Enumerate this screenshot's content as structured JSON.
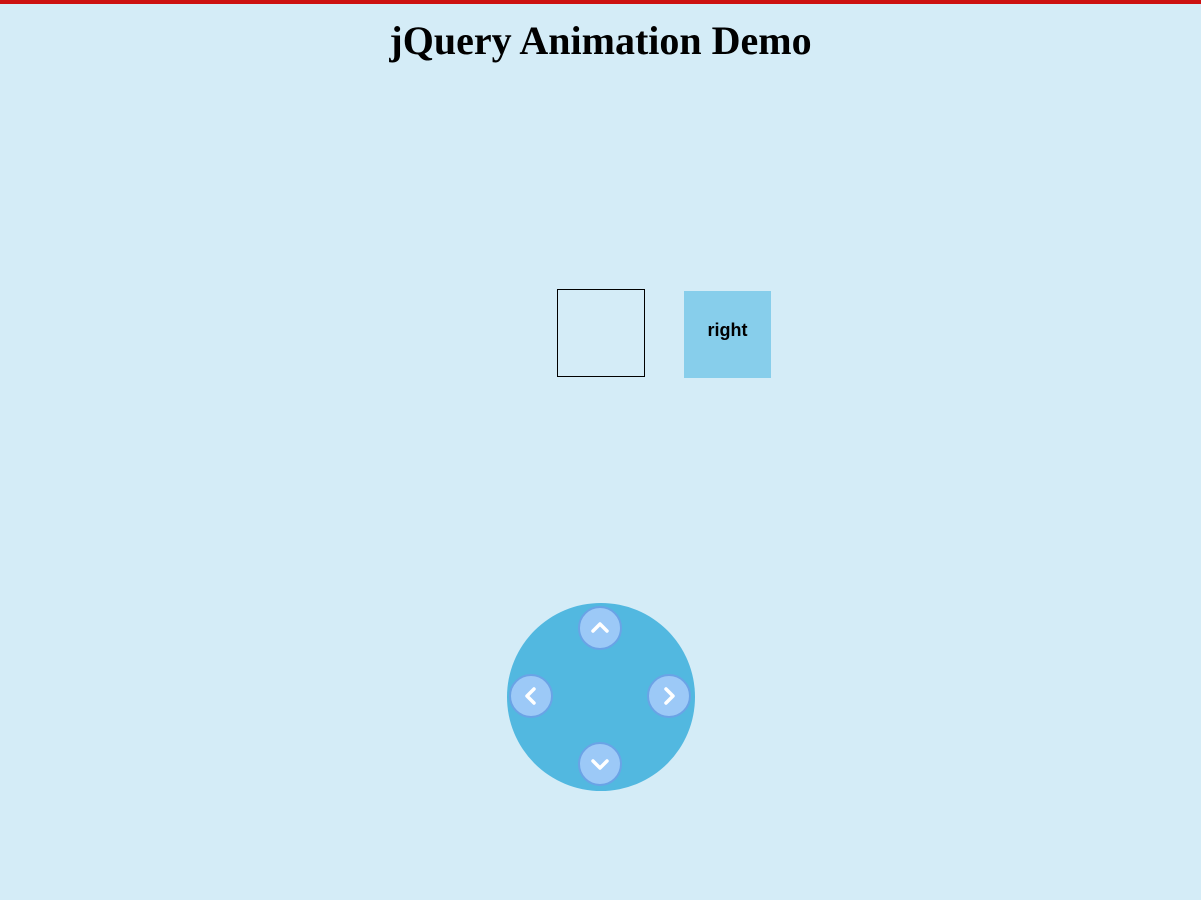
{
  "page": {
    "title": "jQuery Animation Demo"
  },
  "animated_box": {
    "label": "right"
  },
  "controls": {
    "up": {
      "icon": "chevron-up-icon"
    },
    "down": {
      "icon": "chevron-down-icon"
    },
    "left": {
      "icon": "chevron-left-icon"
    },
    "right": {
      "icon": "chevron-right-icon"
    }
  },
  "colors": {
    "background": "#d4ecf7",
    "top_bar": "#cc1111",
    "box": "#87ceeb",
    "dpad": "#52b8e0",
    "dpad_button": "#9cc9f7"
  }
}
